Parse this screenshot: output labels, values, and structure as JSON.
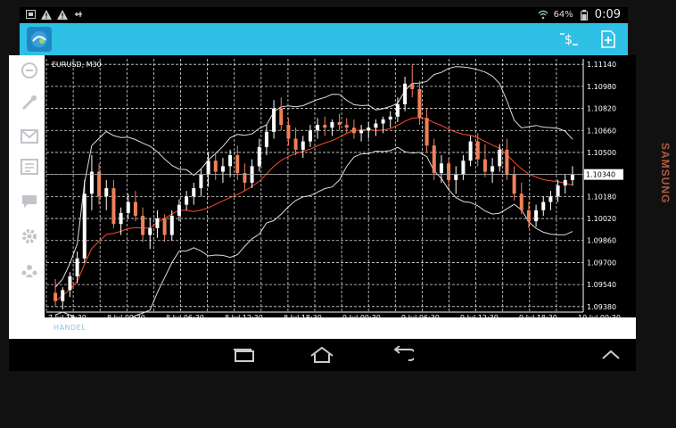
{
  "status_bar": {
    "battery": "64%",
    "time": "0:09",
    "left_icons": [
      "notification-icon",
      "warning-icon",
      "warning-icon",
      "usb-icon"
    ],
    "right_icons": [
      "wifi-icon",
      "signal-icon",
      "battery-icon"
    ]
  },
  "app_bar": {
    "icons": [
      "metatrader-logo-icon",
      "trade-dollar-icon",
      "add-chart-icon"
    ],
    "color": "#2fc0e6"
  },
  "sidebar": {
    "items": [
      {
        "icon": "quotes-icon"
      },
      {
        "icon": "chart-icon"
      },
      {
        "icon": "mail-icon"
      },
      {
        "icon": "news-icon"
      },
      {
        "icon": "chat-icon"
      },
      {
        "icon": "settings-icon"
      },
      {
        "icon": "community-icon"
      }
    ]
  },
  "bottom_bar": {
    "label": "HANDEL"
  },
  "device": {
    "brand": "SAMSUNG"
  },
  "nav_bar": {
    "buttons": [
      "recent-apps-icon",
      "home-icon",
      "back-icon",
      "chevron-up-icon"
    ]
  },
  "chart_data": {
    "type": "candlestick",
    "symbol": "EURUSD, M30",
    "current_price": "1.10340",
    "y_ticks": [
      "1.11140",
      "1.10980",
      "1.10820",
      "1.10660",
      "1.10500",
      "1.10340",
      "1.10180",
      "1.10020",
      "1.09860",
      "1.09700",
      "1.09540",
      "1.09380"
    ],
    "x_ticks": [
      "7 Jul 18:30",
      "8 Jul 00:30",
      "8 Jul 06:30",
      "8 Jul 12:30",
      "8 Jul 18:30",
      "9 Jul 00:30",
      "9 Jul 06:30",
      "9 Jul 12:30",
      "9 Jul 18:30",
      "10 Jul 00:30"
    ],
    "grid": true,
    "indicators": [
      "Bollinger Bands",
      "Moving Average"
    ],
    "colors": {
      "bull": "#ffffff",
      "bear": "#f0805a",
      "ma": "#ff4a2a",
      "band": "#dddddd",
      "green_band": "#7ed07e"
    },
    "candles": [
      [
        1.0948,
        1.0958,
        1.0938,
        1.0942
      ],
      [
        1.0942,
        1.0952,
        1.0936,
        1.095
      ],
      [
        1.095,
        1.0963,
        1.0945,
        1.096
      ],
      [
        1.096,
        1.0978,
        1.0955,
        1.0973
      ],
      [
        1.0973,
        1.103,
        1.097,
        1.102
      ],
      [
        1.102,
        1.1048,
        1.1008,
        1.1036
      ],
      [
        1.1036,
        1.1042,
        1.1012,
        1.1018
      ],
      [
        1.1018,
        1.103,
        1.1008,
        1.1024
      ],
      [
        1.1024,
        1.103,
        1.0995,
        1.0998
      ],
      [
        1.0998,
        1.101,
        1.099,
        1.1006
      ],
      [
        1.1006,
        1.102,
        1.1002,
        1.1014
      ],
      [
        1.1014,
        1.1022,
        1.1,
        1.1004
      ],
      [
        1.1004,
        1.101,
        1.0985,
        1.099
      ],
      [
        1.099,
        1.1002,
        1.098,
        1.0995
      ],
      [
        1.0995,
        1.1008,
        1.0988,
        1.1002
      ],
      [
        1.1002,
        1.1005,
        1.0985,
        1.099
      ],
      [
        1.099,
        1.1008,
        1.0986,
        1.1004
      ],
      [
        1.1004,
        1.1016,
        1.1,
        1.1012
      ],
      [
        1.1012,
        1.1022,
        1.1008,
        1.1018
      ],
      [
        1.1018,
        1.1028,
        1.1012,
        1.1024
      ],
      [
        1.1024,
        1.1038,
        1.1018,
        1.1034
      ],
      [
        1.1034,
        1.105,
        1.1025,
        1.1044
      ],
      [
        1.1044,
        1.105,
        1.103,
        1.1036
      ],
      [
        1.1036,
        1.1046,
        1.1028,
        1.104
      ],
      [
        1.104,
        1.1052,
        1.1032,
        1.1048
      ],
      [
        1.1048,
        1.1055,
        1.103,
        1.1035
      ],
      [
        1.1035,
        1.1042,
        1.1022,
        1.1028
      ],
      [
        1.1028,
        1.1045,
        1.1024,
        1.104
      ],
      [
        1.104,
        1.106,
        1.1036,
        1.1054
      ],
      [
        1.1054,
        1.107,
        1.1048,
        1.1065
      ],
      [
        1.1065,
        1.1088,
        1.106,
        1.1082
      ],
      [
        1.1082,
        1.109,
        1.1066,
        1.107
      ],
      [
        1.107,
        1.1075,
        1.1055,
        1.106
      ],
      [
        1.106,
        1.1068,
        1.1048,
        1.1052
      ],
      [
        1.1052,
        1.1062,
        1.1046,
        1.1058
      ],
      [
        1.1058,
        1.107,
        1.1054,
        1.1066
      ],
      [
        1.1066,
        1.1075,
        1.106,
        1.107
      ],
      [
        1.107,
        1.1076,
        1.1062,
        1.1068
      ],
      [
        1.1068,
        1.1074,
        1.1062,
        1.1072
      ],
      [
        1.1072,
        1.1078,
        1.1066,
        1.107
      ],
      [
        1.107,
        1.1075,
        1.1064,
        1.1068
      ],
      [
        1.1068,
        1.1074,
        1.106,
        1.1064
      ],
      [
        1.1064,
        1.107,
        1.1058,
        1.1066
      ],
      [
        1.1066,
        1.1072,
        1.106,
        1.1068
      ],
      [
        1.1068,
        1.1074,
        1.1062,
        1.1071
      ],
      [
        1.1071,
        1.1076,
        1.1064,
        1.1074
      ],
      [
        1.1074,
        1.108,
        1.1068,
        1.1076
      ],
      [
        1.1076,
        1.109,
        1.1072,
        1.1085
      ],
      [
        1.1085,
        1.1105,
        1.108,
        1.11
      ],
      [
        1.11,
        1.1114,
        1.109,
        1.1096
      ],
      [
        1.1096,
        1.1102,
        1.107,
        1.1075
      ],
      [
        1.1075,
        1.1082,
        1.105,
        1.1055
      ],
      [
        1.1055,
        1.106,
        1.103,
        1.1035
      ],
      [
        1.1035,
        1.1048,
        1.1028,
        1.1042
      ],
      [
        1.1042,
        1.1046,
        1.1024,
        1.103
      ],
      [
        1.103,
        1.104,
        1.102,
        1.1034
      ],
      [
        1.1034,
        1.1048,
        1.103,
        1.1044
      ],
      [
        1.1044,
        1.1062,
        1.104,
        1.1058
      ],
      [
        1.1058,
        1.1064,
        1.104,
        1.1045
      ],
      [
        1.1045,
        1.1056,
        1.1032,
        1.1036
      ],
      [
        1.1036,
        1.1046,
        1.1028,
        1.104
      ],
      [
        1.104,
        1.1056,
        1.1036,
        1.1052
      ],
      [
        1.1052,
        1.106,
        1.103,
        1.1034
      ],
      [
        1.1034,
        1.104,
        1.1015,
        1.102
      ],
      [
        1.102,
        1.1028,
        1.1005,
        1.1008
      ],
      [
        1.1008,
        1.1014,
        1.0995,
        1.1
      ],
      [
        1.1,
        1.1012,
        1.0996,
        1.1008
      ],
      [
        1.1008,
        1.1018,
        1.1004,
        1.1014
      ],
      [
        1.1014,
        1.1022,
        1.1008,
        1.1018
      ],
      [
        1.1018,
        1.103,
        1.1014,
        1.1026
      ],
      [
        1.1026,
        1.1034,
        1.102,
        1.103
      ],
      [
        1.103,
        1.104,
        1.1026,
        1.1034
      ]
    ]
  }
}
